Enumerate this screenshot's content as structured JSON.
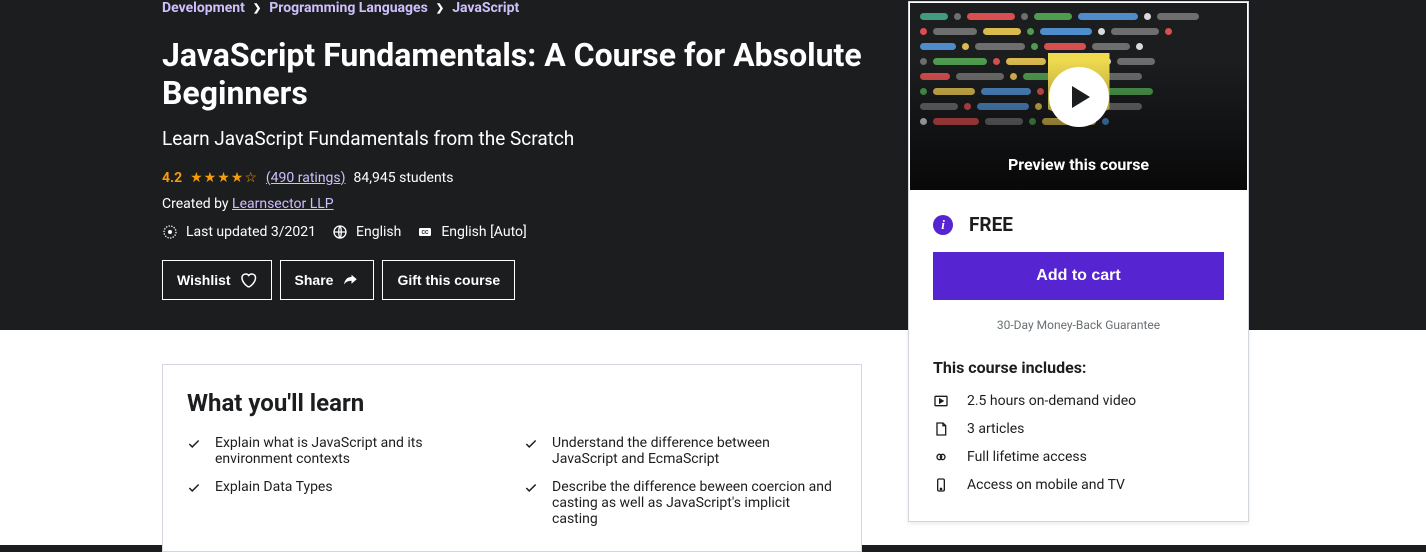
{
  "breadcrumb": {
    "level1": "Development",
    "level2": "Programming Languages",
    "level3": "JavaScript"
  },
  "course": {
    "title": "JavaScript Fundamentals: A Course for Absolute Beginners",
    "subtitle": "Learn JavaScript Fundamentals from the Scratch",
    "rating": "4.2",
    "rating_count": "(490 ratings)",
    "students": "84,945 students",
    "created_by_prefix": "Created by ",
    "creator": "Learnsector LLP",
    "last_updated": "Last updated 3/2021",
    "language": "English",
    "captions": "English [Auto]"
  },
  "actions": {
    "wishlist": "Wishlist",
    "share": "Share",
    "gift": "Gift this course"
  },
  "learn": {
    "title": "What you'll learn",
    "items": [
      "Explain what is JavaScript and its environment contexts",
      "Understand the difference between JavaScript and EcmaScript",
      "Explain Data Types",
      "Describe the difference beween coercion and casting as well as JavaScript's implicit casting"
    ]
  },
  "sidebar": {
    "preview_label": "Preview this course",
    "price": "FREE",
    "add_to_cart": "Add to cart",
    "guarantee": "30-Day Money-Back Guarantee",
    "includes_title": "This course includes:",
    "includes": [
      "2.5 hours on-demand video",
      "3 articles",
      "Full lifetime access",
      "Access on mobile and TV"
    ]
  }
}
